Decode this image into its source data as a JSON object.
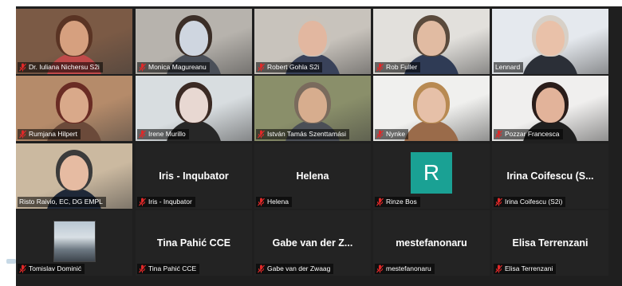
{
  "meeting": {
    "participants": [
      {
        "label": "Dr. Iuliana Nichersu S2i",
        "video": true,
        "muted": true,
        "bg": "#7b5a45",
        "face": "#d6a07f",
        "hair": "#5a3424",
        "shirt": "#c04a4a"
      },
      {
        "label": "Monica Magureanu",
        "video": true,
        "muted": true,
        "bg": "#b7b3ad",
        "face": "#cfd6e0",
        "hair": "#3b2e27",
        "shirt": "#4a4f58"
      },
      {
        "label": "Robert Gohla S2i",
        "video": true,
        "muted": true,
        "bg": "#c8c3bc",
        "face": "#e2b7a0",
        "hair": "#c9c3bb",
        "shirt": "#39425a"
      },
      {
        "label": "Rob Fuller",
        "video": true,
        "muted": true,
        "bg": "#e2e0dc",
        "face": "#e1bba2",
        "hair": "#5a4a3c",
        "shirt": "#2f3b55"
      },
      {
        "label": "Lennard",
        "video": true,
        "muted": false,
        "bg": "#e5e9ee",
        "face": "#e9c1a9",
        "hair": "#d7d0c7",
        "shirt": "#2b2f37"
      },
      {
        "label": "Rumjana Hilpert",
        "video": true,
        "muted": true,
        "bg": "#b58b6a",
        "face": "#d9a98a",
        "hair": "#6a2c24",
        "shirt": "#6b4a3a"
      },
      {
        "label": "Irene Murillo",
        "video": true,
        "muted": true,
        "bg": "#d8dde0",
        "face": "#e8d8d2",
        "hair": "#3b2a24",
        "shirt": "#272727"
      },
      {
        "label": "István Tamás Szenttamási",
        "video": true,
        "muted": true,
        "bg": "#8a8f6a",
        "face": "#d7ad8e",
        "hair": "#7a6b5d",
        "shirt": "#4b4f56"
      },
      {
        "label": "Nynke",
        "video": true,
        "muted": true,
        "bg": "#f0f0ee",
        "face": "#e6c0a8",
        "hair": "#b88a52",
        "shirt": "#9a6b4a"
      },
      {
        "label": "Pozzar Francesca",
        "video": true,
        "muted": true,
        "bg": "#f0efee",
        "face": "#e2b39a",
        "hair": "#2a1d1a",
        "shirt": "#1f1f1f"
      },
      {
        "label": "Risto Raivio, EC, DG EMPL",
        "video": true,
        "muted": false,
        "active": true,
        "bg": "#cbb9a0",
        "face": "#e6bba2",
        "hair": "#3b3b3b",
        "shirt": "#1f2838"
      },
      {
        "label": "Iris - Inqubator",
        "video": false,
        "muted": true,
        "display_name": "Iris - Inqubator"
      },
      {
        "label": "Helena",
        "video": false,
        "muted": true,
        "display_name": "Helena"
      },
      {
        "label": "Rinze Bos",
        "video": false,
        "muted": true,
        "avatar_letter": "R"
      },
      {
        "label": "Irina Coifescu (S2i)",
        "video": false,
        "muted": true,
        "display_name": "Irina Coifescu (S..."
      },
      {
        "label": "Tomislav Dominić",
        "video": false,
        "muted": true,
        "thumbnail": true
      },
      {
        "label": "Tina Pahić CCE",
        "video": false,
        "muted": true,
        "display_name": "Tina Pahić CCE"
      },
      {
        "label": "Gabe van der Zwaag",
        "video": false,
        "muted": true,
        "display_name": "Gabe van der Z..."
      },
      {
        "label": "mestefanonaru",
        "video": false,
        "muted": true,
        "display_name": "mestefanonaru"
      },
      {
        "label": "Elisa Terrenzani",
        "video": false,
        "muted": true,
        "display_name": "Elisa Terrenzani"
      }
    ]
  },
  "colors": {
    "muted_icon": "#e02828",
    "active_border": "#e6d44d",
    "avatar": "#1aa194"
  }
}
